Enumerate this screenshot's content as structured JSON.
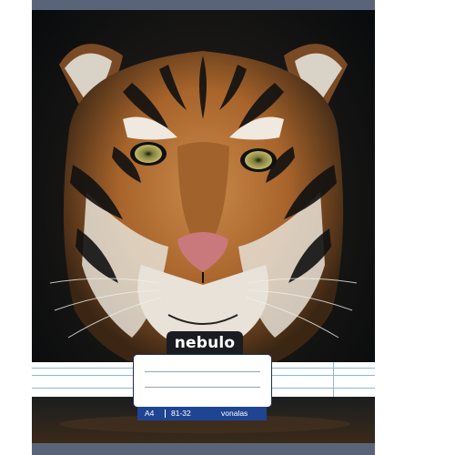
{
  "brand": {
    "name": "nebulo"
  },
  "format": {
    "size": "A4",
    "code": "81-32",
    "ruling": "vonalas"
  },
  "colors": {
    "strip": "#5a6479",
    "label_border": "#1d2f5a",
    "info_bar": "#1f4592",
    "rule": "#8fb5da"
  },
  "icons": {
    "subject": "tiger-face-photo"
  }
}
